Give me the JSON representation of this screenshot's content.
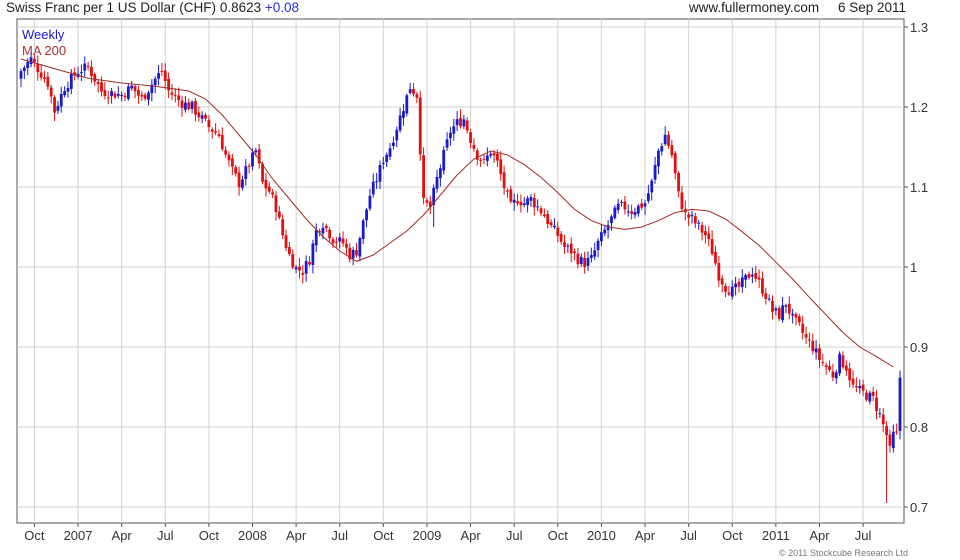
{
  "header": {
    "title": "Swiss Franc per 1 US Dollar (CHF)",
    "last": "0.8623",
    "change": "+0.08",
    "website": "www.fullermoney.com",
    "date": "6 Sep 2011"
  },
  "footer": {
    "copyright": "© 2011 Stockcube Research Ltd"
  },
  "colors": {
    "up": "#1a1acc",
    "down": "#e01010",
    "ma": "#a52a2a",
    "grid": "#d2d2d2",
    "frame": "#555555"
  },
  "chart_data": {
    "type": "candlestick",
    "title": "Swiss Franc per 1 US Dollar (CHF)",
    "ylim": [
      0.68,
      1.31
    ],
    "yticks": [
      1.3,
      1.2,
      1.1,
      1.0,
      0.9,
      0.8,
      0.7
    ],
    "ytick_labels": [
      "1.3",
      "1.2",
      "1.1",
      "1",
      "0.9",
      "0.8",
      "0.7"
    ],
    "xlim": [
      0,
      262
    ],
    "xticks": [
      {
        "label": "Oct",
        "x": 4
      },
      {
        "label": "2007",
        "x": 17
      },
      {
        "label": "Apr",
        "x": 30
      },
      {
        "label": "Jul",
        "x": 43
      },
      {
        "label": "Oct",
        "x": 56
      },
      {
        "label": "2008",
        "x": 69
      },
      {
        "label": "Apr",
        "x": 82
      },
      {
        "label": "Jul",
        "x": 95
      },
      {
        "label": "Oct",
        "x": 108
      },
      {
        "label": "2009",
        "x": 121
      },
      {
        "label": "Apr",
        "x": 134
      },
      {
        "label": "Jul",
        "x": 147
      },
      {
        "label": "Oct",
        "x": 160
      },
      {
        "label": "2010",
        "x": 173
      },
      {
        "label": "Apr",
        "x": 186
      },
      {
        "label": "Jul",
        "x": 199
      },
      {
        "label": "Oct",
        "x": 212
      },
      {
        "label": "2011",
        "x": 225
      },
      {
        "label": "Apr",
        "x": 238
      },
      {
        "label": "Jul",
        "x": 251
      }
    ],
    "series": [
      {
        "name": "Weekly",
        "kind": "weekly candles (blue = up week, red = down week)",
        "anchors_close": [
          [
            0,
            1.245
          ],
          [
            3,
            1.26
          ],
          [
            8,
            1.23
          ],
          [
            10,
            1.195
          ],
          [
            13,
            1.225
          ],
          [
            17,
            1.245
          ],
          [
            20,
            1.25
          ],
          [
            24,
            1.22
          ],
          [
            30,
            1.215
          ],
          [
            33,
            1.225
          ],
          [
            36,
            1.21
          ],
          [
            40,
            1.235
          ],
          [
            42,
            1.245
          ],
          [
            44,
            1.22
          ],
          [
            48,
            1.205
          ],
          [
            51,
            1.2
          ],
          [
            54,
            1.185
          ],
          [
            56,
            1.175
          ],
          [
            59,
            1.165
          ],
          [
            61,
            1.14
          ],
          [
            63,
            1.12
          ],
          [
            65,
            1.105
          ],
          [
            67,
            1.12
          ],
          [
            70,
            1.145
          ],
          [
            72,
            1.105
          ],
          [
            74,
            1.095
          ],
          [
            76,
            1.075
          ],
          [
            78,
            1.04
          ],
          [
            80,
            1.015
          ],
          [
            82,
            0.998
          ],
          [
            84,
            0.995
          ],
          [
            86,
            1.01
          ],
          [
            88,
            1.045
          ],
          [
            90,
            1.055
          ],
          [
            93,
            1.035
          ],
          [
            96,
            1.03
          ],
          [
            98,
            1.015
          ],
          [
            100,
            1.02
          ],
          [
            102,
            1.055
          ],
          [
            104,
            1.09
          ],
          [
            106,
            1.11
          ],
          [
            108,
            1.135
          ],
          [
            110,
            1.15
          ],
          [
            112,
            1.175
          ],
          [
            114,
            1.2
          ],
          [
            116,
            1.225
          ],
          [
            118,
            1.215
          ],
          [
            120,
            1.08
          ],
          [
            122,
            1.075
          ],
          [
            124,
            1.11
          ],
          [
            126,
            1.14
          ],
          [
            128,
            1.17
          ],
          [
            130,
            1.18
          ],
          [
            132,
            1.185
          ],
          [
            134,
            1.16
          ],
          [
            136,
            1.14
          ],
          [
            138,
            1.13
          ],
          [
            140,
            1.145
          ],
          [
            142,
            1.13
          ],
          [
            144,
            1.1
          ],
          [
            146,
            1.075
          ],
          [
            148,
            1.085
          ],
          [
            150,
            1.08
          ],
          [
            152,
            1.085
          ],
          [
            154,
            1.075
          ],
          [
            156,
            1.065
          ],
          [
            158,
            1.05
          ],
          [
            160,
            1.04
          ],
          [
            162,
            1.025
          ],
          [
            164,
            1.02
          ],
          [
            166,
            1.01
          ],
          [
            168,
            1.005
          ],
          [
            170,
            1.01
          ],
          [
            172,
            1.03
          ],
          [
            174,
            1.045
          ],
          [
            176,
            1.06
          ],
          [
            178,
            1.075
          ],
          [
            180,
            1.075
          ],
          [
            182,
            1.07
          ],
          [
            184,
            1.075
          ],
          [
            186,
            1.08
          ],
          [
            188,
            1.105
          ],
          [
            190,
            1.145
          ],
          [
            192,
            1.165
          ],
          [
            194,
            1.14
          ],
          [
            196,
            1.09
          ],
          [
            198,
            1.065
          ],
          [
            200,
            1.06
          ],
          [
            202,
            1.05
          ],
          [
            204,
            1.04
          ],
          [
            206,
            1.02
          ],
          [
            208,
            0.99
          ],
          [
            210,
            0.975
          ],
          [
            212,
            0.97
          ],
          [
            214,
            0.975
          ],
          [
            216,
            0.985
          ],
          [
            218,
            0.995
          ],
          [
            220,
            0.98
          ],
          [
            222,
            0.965
          ],
          [
            224,
            0.945
          ],
          [
            226,
            0.94
          ],
          [
            228,
            0.955
          ],
          [
            230,
            0.935
          ],
          [
            232,
            0.925
          ],
          [
            234,
            0.91
          ],
          [
            236,
            0.9
          ],
          [
            238,
            0.885
          ],
          [
            240,
            0.875
          ],
          [
            242,
            0.865
          ],
          [
            244,
            0.885
          ],
          [
            246,
            0.875
          ],
          [
            248,
            0.85
          ],
          [
            250,
            0.845
          ],
          [
            252,
            0.84
          ],
          [
            254,
            0.835
          ],
          [
            256,
            0.815
          ],
          [
            258,
            0.79
          ],
          [
            259,
            0.77
          ],
          [
            260,
            0.79
          ],
          [
            261,
            0.79
          ],
          [
            262,
            0.8623
          ]
        ],
        "notable_lows": [
          [
            0,
            1.225
          ],
          [
            10,
            1.185
          ],
          [
            84,
            0.98
          ],
          [
            123,
            1.05
          ],
          [
            169,
            0.995
          ],
          [
            258,
            0.705
          ]
        ],
        "notable_highs": [
          [
            3,
            1.265
          ],
          [
            42,
            1.25
          ],
          [
            116,
            1.23
          ],
          [
            130,
            1.195
          ],
          [
            192,
            1.175
          ],
          [
            262,
            0.865
          ]
        ]
      },
      {
        "name": "MA 200",
        "kind": "moving average",
        "x": [
          0,
          10,
          20,
          30,
          40,
          50,
          55,
          60,
          65,
          70,
          75,
          80,
          85,
          90,
          95,
          100,
          105,
          110,
          115,
          120,
          125,
          130,
          135,
          140,
          145,
          150,
          155,
          160,
          165,
          170,
          175,
          180,
          185,
          190,
          195,
          200,
          205,
          210,
          215,
          220,
          225,
          230,
          235,
          240,
          245,
          250,
          255,
          260
        ],
        "y": [
          1.26,
          1.248,
          1.236,
          1.23,
          1.226,
          1.22,
          1.21,
          1.19,
          1.165,
          1.14,
          1.11,
          1.085,
          1.06,
          1.038,
          1.02,
          1.007,
          1.015,
          1.03,
          1.045,
          1.065,
          1.09,
          1.115,
          1.135,
          1.145,
          1.14,
          1.128,
          1.112,
          1.093,
          1.072,
          1.058,
          1.05,
          1.047,
          1.05,
          1.058,
          1.068,
          1.072,
          1.07,
          1.06,
          1.044,
          1.027,
          1.006,
          0.985,
          0.962,
          0.94,
          0.918,
          0.9,
          0.888,
          0.875
        ]
      }
    ],
    "legend": [
      "Weekly",
      "MA 200"
    ],
    "legend_position": "top-left",
    "grid": true,
    "yaxis_side": "right"
  }
}
